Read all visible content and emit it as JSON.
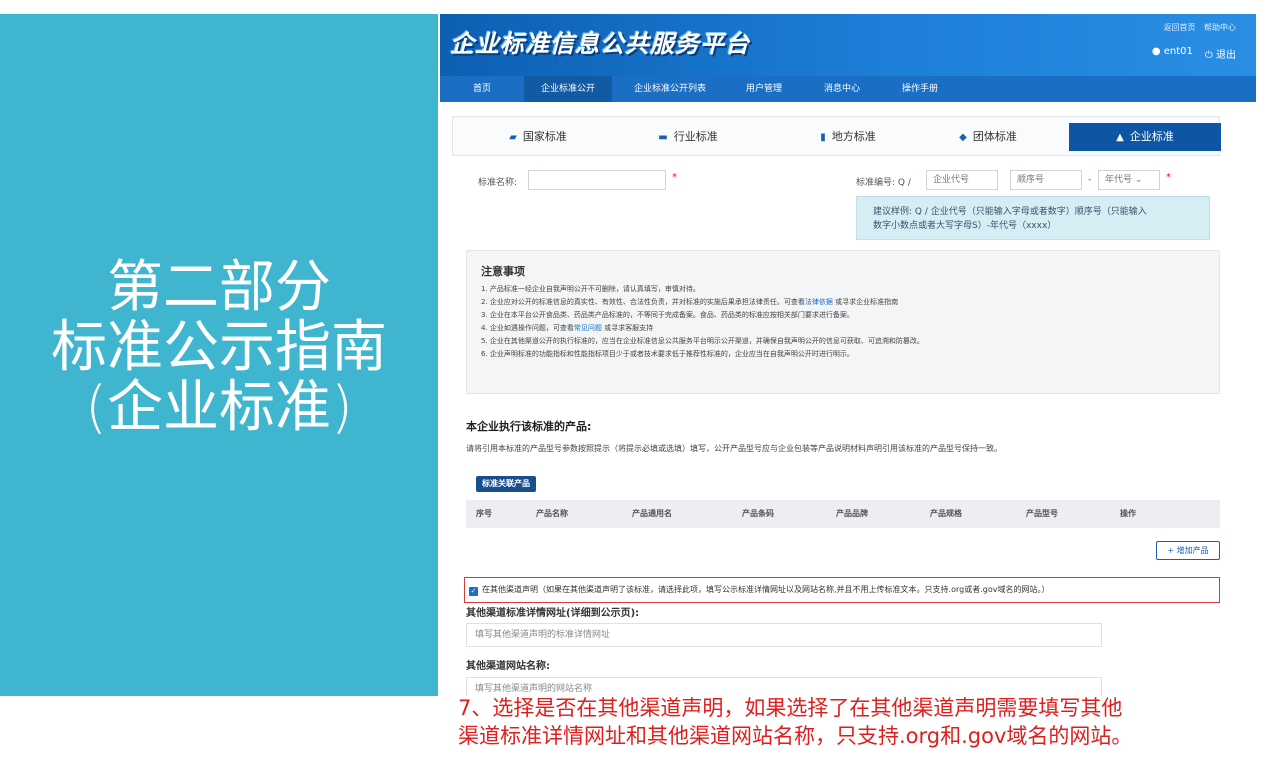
{
  "slide": {
    "title_lines": [
      "第二部分",
      "标准公示指南",
      "(企业标准)"
    ],
    "caption_lines": [
      "7、选择是否在其他渠道声明，如果选择了在其他渠道声明需要填写其他",
      "渠道标准详情网址和其他渠道网站名称，只支持.org和.gov域名的网站。"
    ]
  },
  "app": {
    "logo": "企业标准信息公共服务平台",
    "top_links": [
      "返回首页",
      "帮助中心"
    ],
    "user": "ent01",
    "logout": "退出",
    "nav": [
      "首页",
      "企业标准公开",
      "企业标准公开列表",
      "用户管理",
      "消息中心",
      "操作手册"
    ],
    "tabs": [
      {
        "label": "国家标准",
        "icon": "book-icon"
      },
      {
        "label": "行业标准",
        "icon": "briefcase-icon"
      },
      {
        "label": "地方标准",
        "icon": "file-icon"
      },
      {
        "label": "团体标准",
        "icon": "shield-icon"
      },
      {
        "label": "企业标准",
        "icon": "bank-icon"
      }
    ],
    "form": {
      "name_label": "标准名称:",
      "code_label": "标准编号: Q /",
      "enterprise_code_placeholder": "企业代号",
      "seq_placeholder": "顺序号",
      "dash": "-",
      "year_select": "年代号",
      "required_mark": "*",
      "hint": [
        "建议样例:  Q / 企业代号（只能输入字母或者数字）顺序号（只能输入",
        "数字小数点或者大写字母S）-年代号（xxxx）"
      ]
    },
    "notice": {
      "title": "注意事项",
      "lines": [
        {
          "text": "1. 产品标准一经企业自我声明公开不可删除，请认真填写，审慎对待。",
          "link": "",
          "tail": ""
        },
        {
          "text": "2. 企业应对公开的标准信息的真实性、有效性、合法性负责，并对标准的实施后果承担法律责任。可查看",
          "link": "法律依据",
          "tail": "或寻求企业标准指南"
        },
        {
          "text": "3. 企业在本平台公开食品类、药品类产品标准的，不等同于完成备案。食品、药品类的标准应按相关部门要求进行备案。",
          "link": "",
          "tail": ""
        },
        {
          "text": "4. 企业如遇操作问题，可查看",
          "link": "常见问题",
          "tail": "或寻求客服支持"
        },
        {
          "text": "5. 企业在其他渠道公开的执行标准的，应当在企业标准信息公共服务平台明示公开渠道，并确保自我声明公开的信息可获取、可追溯和防篡改。",
          "link": "",
          "tail": ""
        },
        {
          "text": "6. 企业声明标准的功能指标和性能指标项目少于或者技术要求低于推荐性标准的，企业应当在自我声明公开时进行明示。",
          "link": "",
          "tail": ""
        }
      ]
    },
    "products": {
      "title": "本企业执行该标准的产品:",
      "desc": "请将引用本标准的产品型号参数按照提示（将提示必填或选填）填写，公开产品型号应与企业包装等产品说明材料声明引用该标准的产品型号保持一致。",
      "badge": "标准关联产品",
      "columns": [
        "序号",
        "产品名称",
        "产品通用名",
        "产品条码",
        "产品品牌",
        "产品规格",
        "产品型号",
        "操作"
      ],
      "add_button": "+ 增加产品"
    },
    "other_channel": {
      "checkbox_label": "在其他渠道声明（如果在其他渠道声明了该标准，请选择此项，填写公示标准详情网址以及网站名称,并且不用上传标准文本。只支持.org或者.gov域名的网站。）",
      "url_label": "其他渠道标准详情网址(详细到公示页):",
      "url_placeholder": "填写其他渠道声明的标准详情网址",
      "site_label": "其他渠道网站名称:",
      "site_placeholder": "填写其他渠道声明的网站名称"
    }
  }
}
